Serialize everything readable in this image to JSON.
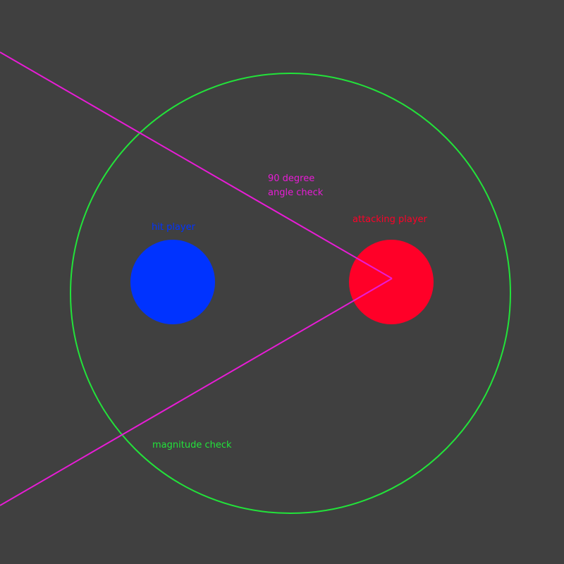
{
  "background_color": "#404040",
  "magnitude_circle": {
    "color": "#22E33A",
    "label": "magnitude check"
  },
  "hit_player": {
    "color": "#0033FF",
    "label": "hit player"
  },
  "attacking_player": {
    "color": "#FF0028",
    "label": "attacking player"
  },
  "angle_check": {
    "color": "#E81CD6",
    "label_line1": "90 degree",
    "label_line2": "angle check"
  }
}
